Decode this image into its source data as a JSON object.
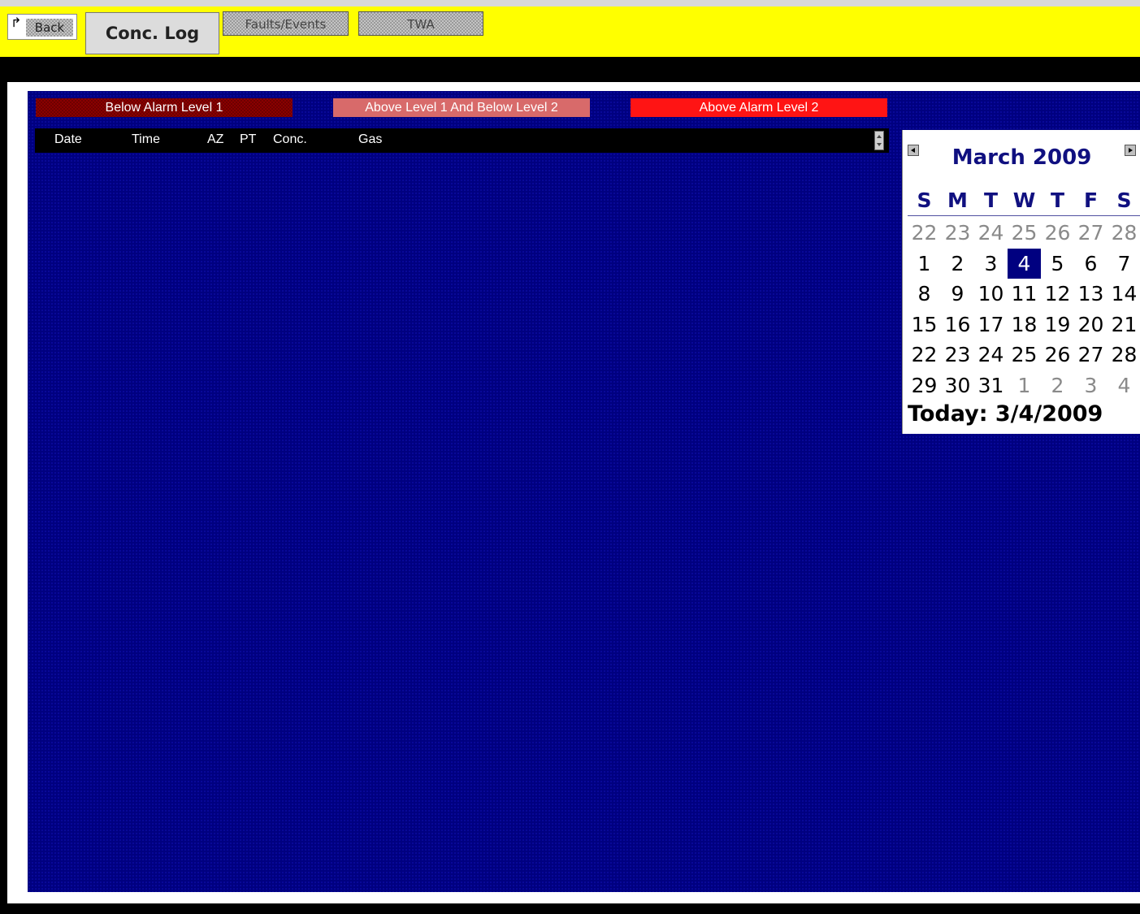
{
  "toolbar": {
    "back_label": "Back",
    "back_arrow": "↱",
    "tabs": [
      {
        "label": "Conc. Log",
        "active": true
      },
      {
        "label": "Faults/Events",
        "active": false
      },
      {
        "label": "TWA",
        "active": false
      }
    ]
  },
  "legend": [
    {
      "label": "Below Alarm Level 1",
      "color": "#8a0000"
    },
    {
      "label": "Above Level 1 And Below Level 2",
      "color": "#d86a6a"
    },
    {
      "label": "Above Alarm Level 2",
      "color": "#ff1414"
    }
  ],
  "table": {
    "columns": [
      "Date",
      "Time",
      "AZ",
      "PT",
      "Conc.",
      "Gas"
    ],
    "rows": []
  },
  "calendar": {
    "title": "March 2009",
    "days_of_week": [
      "S",
      "M",
      "T",
      "W",
      "T",
      "F",
      "S"
    ],
    "weeks": [
      [
        {
          "d": "22",
          "o": true
        },
        {
          "d": "23",
          "o": true
        },
        {
          "d": "24",
          "o": true
        },
        {
          "d": "25",
          "o": true
        },
        {
          "d": "26",
          "o": true
        },
        {
          "d": "27",
          "o": true
        },
        {
          "d": "28",
          "o": true
        }
      ],
      [
        {
          "d": "1"
        },
        {
          "d": "2"
        },
        {
          "d": "3"
        },
        {
          "d": "4",
          "sel": true
        },
        {
          "d": "5"
        },
        {
          "d": "6"
        },
        {
          "d": "7"
        }
      ],
      [
        {
          "d": "8"
        },
        {
          "d": "9"
        },
        {
          "d": "10"
        },
        {
          "d": "11"
        },
        {
          "d": "12"
        },
        {
          "d": "13"
        },
        {
          "d": "14"
        }
      ],
      [
        {
          "d": "15"
        },
        {
          "d": "16"
        },
        {
          "d": "17"
        },
        {
          "d": "18"
        },
        {
          "d": "19"
        },
        {
          "d": "20"
        },
        {
          "d": "21"
        }
      ],
      [
        {
          "d": "22"
        },
        {
          "d": "23"
        },
        {
          "d": "24"
        },
        {
          "d": "25"
        },
        {
          "d": "26"
        },
        {
          "d": "27"
        },
        {
          "d": "28"
        }
      ],
      [
        {
          "d": "29"
        },
        {
          "d": "30"
        },
        {
          "d": "31"
        },
        {
          "d": "1",
          "o": true
        },
        {
          "d": "2",
          "o": true
        },
        {
          "d": "3",
          "o": true
        },
        {
          "d": "4",
          "o": true
        }
      ]
    ],
    "today_label": "Today: 3/4/2009"
  },
  "colors": {
    "toolbar_bg": "#ffff00",
    "panel_bg": "#000080",
    "calendar_accent": "#101080"
  }
}
